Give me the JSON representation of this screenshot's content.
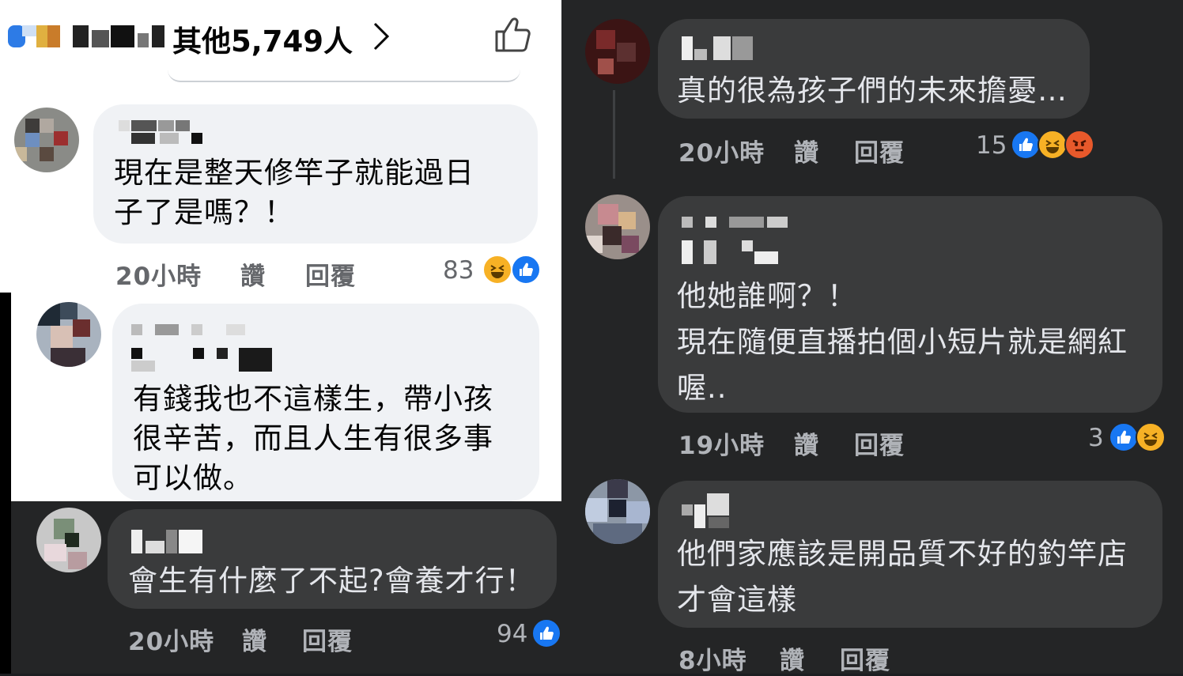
{
  "top": {
    "others_text": "其他5,749人",
    "chevron": "chevron-right-icon",
    "like_icon": "thumbs-up-outline-icon"
  },
  "comments_left": [
    {
      "text": "現在是整天修竿子就能過日\n子了是嗎？！",
      "time": "20小時",
      "like_label": "讚",
      "reply_label": "回覆",
      "reaction_count": "83",
      "reactions": [
        "haha",
        "like"
      ]
    },
    {
      "text": "有錢我也不這樣生，帶小孩\n很辛苦，而且人生有很多事\n可以做。",
      "time": "",
      "like_label": "",
      "reply_label": "",
      "reaction_count": "",
      "reactions": []
    },
    {
      "text": "會生有什麼了不起?會養才行！",
      "time": "20小時",
      "like_label": "讚",
      "reply_label": "回覆",
      "reaction_count": "94",
      "reactions": [
        "like"
      ]
    }
  ],
  "comments_right": [
    {
      "text": "真的很為孩子們的未來擔憂…",
      "time": "20小時",
      "like_label": "讚",
      "reply_label": "回覆",
      "reaction_count": "15",
      "reactions": [
        "like",
        "haha",
        "angry"
      ]
    },
    {
      "text": "他她誰啊？！\n現在隨便直播拍個小短片就是網紅\n喔..",
      "time": "19小時",
      "like_label": "讚",
      "reply_label": "回覆",
      "reaction_count": "3",
      "reactions": [
        "like",
        "haha"
      ]
    },
    {
      "text": "他們家應該是開品質不好的釣竿店\n才會這樣",
      "time": "8小時",
      "like_label": "讚",
      "reply_label": "回覆",
      "reaction_count": "",
      "reactions": []
    }
  ],
  "colors": {
    "light_bg": "#ffffff",
    "light_bubble": "#f0f2f5",
    "dark_bg": "#242526",
    "dark_bubble": "#3a3b3c",
    "like_blue": "#1877f2",
    "haha_yellow": "#f7b125",
    "angry_orange": "#e8592b"
  }
}
